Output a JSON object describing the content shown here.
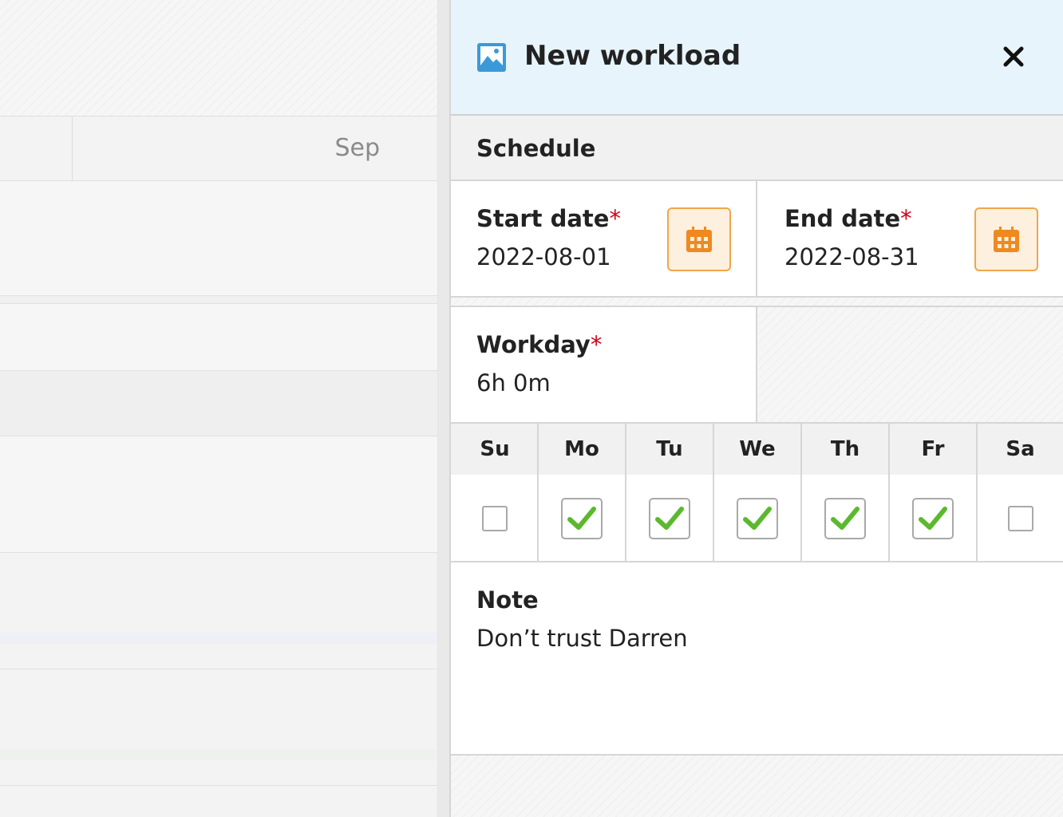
{
  "background": {
    "month_label": "Sep"
  },
  "panel": {
    "title": "New workload",
    "title_icon": "image-icon",
    "close_icon": "close-icon"
  },
  "schedule": {
    "section_title": "Schedule",
    "start_date": {
      "label": "Start date",
      "required_mark": "*",
      "value": "2022-08-01",
      "icon": "calendar-icon"
    },
    "end_date": {
      "label": "End date",
      "required_mark": "*",
      "value": "2022-08-31",
      "icon": "calendar-icon"
    },
    "workday": {
      "label": "Workday",
      "required_mark": "*",
      "value": "6h 0m"
    },
    "days": [
      {
        "label": "Su",
        "checked": false
      },
      {
        "label": "Mo",
        "checked": true
      },
      {
        "label": "Tu",
        "checked": true
      },
      {
        "label": "We",
        "checked": true
      },
      {
        "label": "Th",
        "checked": true
      },
      {
        "label": "Fr",
        "checked": true
      },
      {
        "label": "Sa",
        "checked": false
      }
    ],
    "note": {
      "label": "Note",
      "value": "Don’t trust Darren"
    }
  },
  "colors": {
    "header_bg": "#e8f4fb",
    "accent_orange": "#f0a64a",
    "check_green": "#5cb82e",
    "required_red": "#d0021b"
  }
}
